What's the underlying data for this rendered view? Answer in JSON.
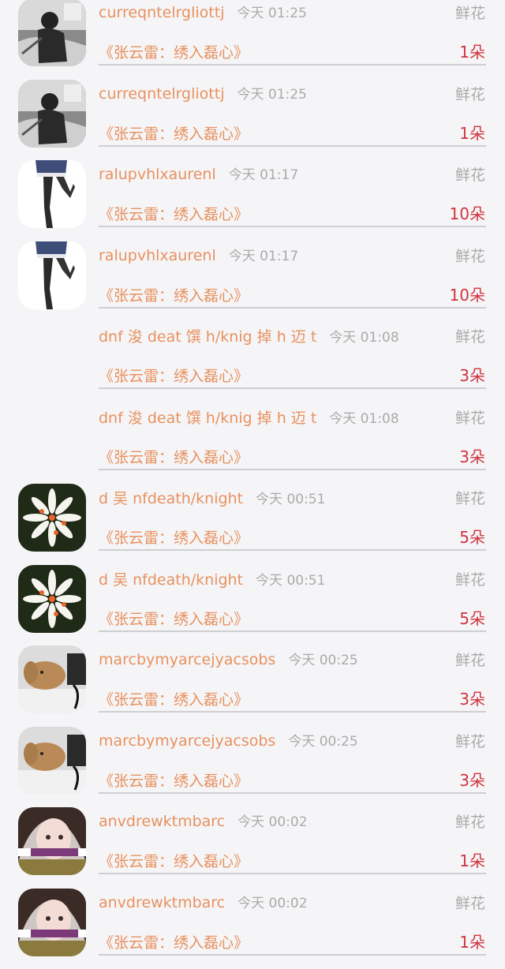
{
  "gifts": [
    {
      "user": "curreqntelrgliottj",
      "time": "今天 01:25",
      "gift_type": "鲜花",
      "work": "《张云雷：绣入磊心》",
      "count": "1朵",
      "avatar": "sketch-photo-avatar"
    },
    {
      "user": "curreqntelrgliottj",
      "time": "今天 01:25",
      "gift_type": "鲜花",
      "work": "《张云雷：绣入磊心》",
      "count": "1朵",
      "avatar": "sketch-photo-avatar"
    },
    {
      "user": "ralupvhlxaurenl",
      "time": "今天 01:17",
      "gift_type": "鲜花",
      "work": "《张云雷：绣入磊心》",
      "count": "10朵",
      "avatar": "legs-photo-avatar"
    },
    {
      "user": "ralupvhlxaurenl",
      "time": "今天 01:17",
      "gift_type": "鲜花",
      "work": "《张云雷：绣入磊心》",
      "count": "10朵",
      "avatar": "legs-photo-avatar"
    },
    {
      "user": "dnf 浚 deat 馔 h/knig 掉 h 迈 t",
      "time": "今天 01:08",
      "gift_type": "鲜花",
      "work": "《张云雷：绣入磊心》",
      "count": "3朵",
      "avatar": "blank-avatar"
    },
    {
      "user": "dnf 浚 deat 馔 h/knig 掉 h 迈 t",
      "time": "今天 01:08",
      "gift_type": "鲜花",
      "work": "《张云雷：绣入磊心》",
      "count": "3朵",
      "avatar": "blank-avatar"
    },
    {
      "user": "d 吴 nfdeath/knight",
      "time": "今天 00:51",
      "gift_type": "鲜花",
      "work": "《张云雷：绣入磊心》",
      "count": "5朵",
      "avatar": "white-flower-avatar"
    },
    {
      "user": "d 吴 nfdeath/knight",
      "time": "今天 00:51",
      "gift_type": "鲜花",
      "work": "《张云雷：绣入磊心》",
      "count": "5朵",
      "avatar": "white-flower-avatar"
    },
    {
      "user": "marcbymyarcejyacsobs",
      "time": "今天 00:25",
      "gift_type": "鲜花",
      "work": "《张云雷：绣入磊心》",
      "count": "3朵",
      "avatar": "rabbit-avatar"
    },
    {
      "user": "marcbymyarcejyacsobs",
      "time": "今天 00:25",
      "gift_type": "鲜花",
      "work": "《张云雷：绣入磊心》",
      "count": "3朵",
      "avatar": "rabbit-avatar"
    },
    {
      "user": "anvdrewktmbarc",
      "time": "今天 00:02",
      "gift_type": "鲜花",
      "work": "《张云雷：绣入磊心》",
      "count": "1朵",
      "avatar": "girl-photo-avatar"
    },
    {
      "user": "anvdrewktmbarc",
      "time": "今天 00:02",
      "gift_type": "鲜花",
      "work": "《张云雷：绣入磊心》",
      "count": "1朵",
      "avatar": "girl-photo-avatar"
    }
  ],
  "colors": {
    "accent": "#e8915f",
    "count": "#d0343f",
    "muted": "#aaaaaa",
    "background": "#f5f5f7"
  }
}
